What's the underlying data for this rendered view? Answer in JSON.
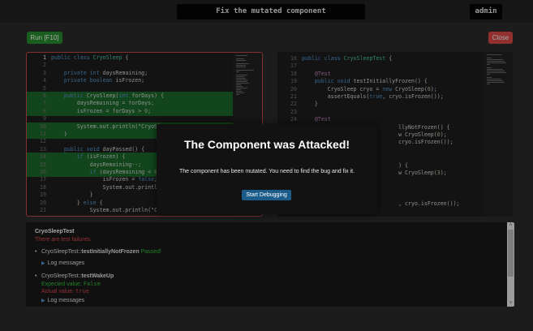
{
  "header": {
    "title": "Fix the mutated component",
    "user": "admin"
  },
  "toolbar": {
    "run_label": "Run [F10]",
    "close_label": "Close"
  },
  "left_editor": {
    "lines": [
      {
        "n": "1",
        "html": "<span class='kw'>public class</span> <span class='ty'>CryoSleep</span> {",
        "hl": false,
        "cur": true
      },
      {
        "n": "2",
        "html": "",
        "hl": false
      },
      {
        "n": "3",
        "html": "    <span class='kw'>private int</span> daysRemaining;",
        "hl": false
      },
      {
        "n": "4",
        "html": "    <span class='kw'>private boolean</span> isFrozen;",
        "hl": false
      },
      {
        "n": "5",
        "html": "",
        "hl": false
      },
      {
        "n": "6",
        "html": "    <span class='kw'>public</span> CryoSleep(<span class='kw'>int</span> forDays) {",
        "hl": true
      },
      {
        "n": "7",
        "html": "        daysRemaining = forDays;",
        "hl": true
      },
      {
        "n": "8",
        "html": "        isFrozen = forDays > <span class='num'>0</span>;",
        "hl": true
      },
      {
        "n": "9",
        "html": "",
        "hl": false
      },
      {
        "n": "10",
        "html": "        System.out.println(\"CryoSle",
        "hl": true
      },
      {
        "n": "11",
        "html": "    }",
        "hl": true
      },
      {
        "n": "12",
        "html": "",
        "hl": false
      },
      {
        "n": "13",
        "html": "    <span class='kw'>public void</span> dayPassed() {",
        "hl": false
      },
      {
        "n": "14",
        "html": "        <span class='kw'>if</span> (isFrozen) {",
        "hl": true
      },
      {
        "n": "15",
        "html": "            daysRemaining--;",
        "hl": true
      },
      {
        "n": "16",
        "html": "            <span class='kw'>if</span> (daysRemaining < <span class='num'>0</span>)",
        "hl": true
      },
      {
        "n": "17",
        "html": "                isFrozen = <span class='kw'>false</span>;",
        "hl": false
      },
      {
        "n": "18",
        "html": "                System.out.println(",
        "hl": false
      },
      {
        "n": "19",
        "html": "            }",
        "hl": false
      },
      {
        "n": "20",
        "html": "        } <span class='kw'>else</span> {",
        "hl": false
      },
      {
        "n": "21",
        "html": "            System.out.println(\"Cry",
        "hl": false
      }
    ]
  },
  "right_editor": {
    "lines": [
      {
        "n": "16",
        "html": "<span class='kw'>public class</span> <span class='ty'>CryoSleepTest</span> {"
      },
      {
        "n": "17",
        "html": ""
      },
      {
        "n": "18",
        "html": "    <span class='an'>@Test</span>"
      },
      {
        "n": "19",
        "html": "    <span class='kw'>public void</span> testInitiallyFrozen() {"
      },
      {
        "n": "20",
        "html": "        CryoSleep cryo = <span class='kw'>new</span> CryoSleep(<span class='num'>6</span>);"
      },
      {
        "n": "21",
        "html": "        assertEquals(<span class='kw'>true</span>, cryo.isFrozen());"
      },
      {
        "n": "22",
        "html": "    }"
      },
      {
        "n": "23",
        "html": ""
      },
      {
        "n": "24",
        "html": "    <span class='an'>@Test</span>"
      },
      {
        "n": "25",
        "html": "                              llyNotFrozen() {"
      },
      {
        "n": "26",
        "html": "                              w CryoSleep(<span class='num'>0</span>);"
      },
      {
        "n": "27",
        "html": "                              cryo.isFrozen());"
      },
      {
        "n": "28",
        "html": ""
      },
      {
        "n": "29",
        "html": ""
      },
      {
        "n": "30",
        "html": "                              ) {"
      },
      {
        "n": "31",
        "html": "                              w CryoSleep(<span class='num'>3</span>);"
      },
      {
        "n": "32",
        "html": ""
      },
      {
        "n": "33",
        "html": ""
      },
      {
        "n": "34",
        "html": ""
      },
      {
        "n": "35",
        "html": "                              , cryo.isFrozen());"
      }
    ]
  },
  "modal": {
    "title": "The Component was Attacked!",
    "message": "The component has been mutated. You need to find the bug and fix it.",
    "button": "Start Debugging"
  },
  "results": {
    "suite": "CryoSleepTest",
    "summary": "There are test failures.",
    "test1_prefix": "CryoSleepTest::",
    "test1_name": "testInitiallyNotFrozen",
    "test1_status": "Passed!",
    "log_label": "Log messages",
    "test2_prefix": "CryoSleepTest::",
    "test2_name": "testWakeUp",
    "expected_label": "Expected value:",
    "expected_value": "False",
    "actual_label": "Actual value:",
    "actual_value": "true",
    "log_label2": "Log messages"
  },
  "colors": {
    "accent_green": "#27912e",
    "accent_red": "#e04a4a",
    "highlight": "#1c6b2a",
    "button_blue": "#1c5c8a"
  }
}
